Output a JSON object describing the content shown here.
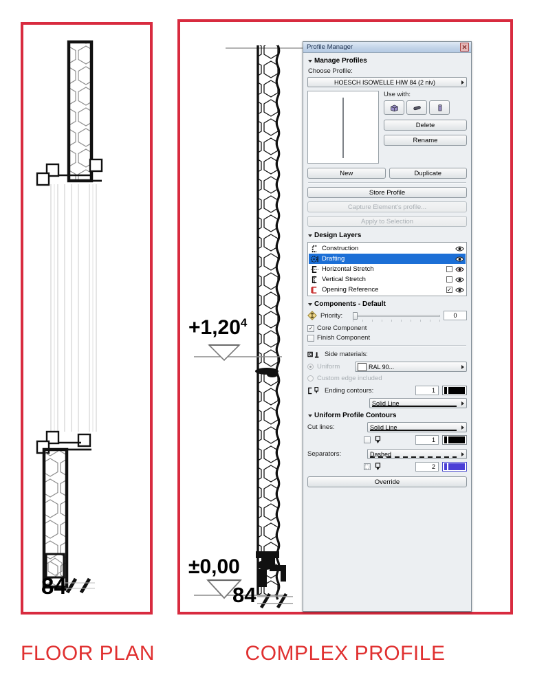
{
  "captions": {
    "floor_plan": "FLOOR PLAN",
    "complex_profile": "COMPLEX PROFILE"
  },
  "colors": {
    "frame_red": "#d82b3f",
    "caption_red": "#e03030",
    "selection_blue": "#1c6fd6",
    "separator_pen": "#4b3fd6"
  },
  "floor_plan_drawing": {
    "dimension_label": "84",
    "hatch": "honeycomb",
    "wall_thickness_label": "84"
  },
  "section_drawing": {
    "upper_level_label": "+1,20",
    "upper_level_superscript": "4",
    "lower_level_label": "±0,00",
    "dimension_label": "84",
    "hatch": "honeycomb"
  },
  "dialog": {
    "title": "Profile Manager",
    "close_icon": "close-icon",
    "manage_profiles": {
      "header": "Manage Profiles",
      "choose_profile_label": "Choose Profile:",
      "selected_profile": "HOESCH ISOWELLE HIW 84 (2 niv)",
      "use_with_label": "Use with:",
      "use_with_icons": [
        "wall-icon",
        "beam-icon",
        "column-icon"
      ],
      "delete_label": "Delete",
      "rename_label": "Rename",
      "new_label": "New",
      "duplicate_label": "Duplicate",
      "store_profile_label": "Store Profile",
      "capture_label": "Capture Element's profile...",
      "apply_label": "Apply to Selection"
    },
    "design_layers": {
      "header": "Design Layers",
      "rows": [
        {
          "name": "Construction",
          "icon": "construction-layer-icon",
          "has_checkbox": false,
          "checked": false,
          "visible": true,
          "selected": false
        },
        {
          "name": "Drafting",
          "icon": "drafting-layer-icon",
          "has_checkbox": false,
          "checked": false,
          "visible": true,
          "selected": true
        },
        {
          "name": "Horizontal Stretch",
          "icon": "horizontal-stretch-layer-icon",
          "has_checkbox": true,
          "checked": false,
          "visible": true,
          "selected": false
        },
        {
          "name": "Vertical Stretch",
          "icon": "vertical-stretch-layer-icon",
          "has_checkbox": true,
          "checked": false,
          "visible": true,
          "selected": false
        },
        {
          "name": "Opening Reference",
          "icon": "opening-reference-layer-icon",
          "has_checkbox": true,
          "checked": true,
          "visible": true,
          "selected": false
        }
      ]
    },
    "components": {
      "header": "Components - Default",
      "priority_label": "Priority:",
      "priority_value": "0",
      "core_component_label": "Core Component",
      "core_component_checked": true,
      "finish_component_label": "Finish Component",
      "finish_component_checked": false,
      "side_materials_label": "Side materials:",
      "uniform_label": "Uniform",
      "uniform_selected": true,
      "uniform_material": "RAL 90...",
      "custom_edge_label": "Custom edge included",
      "custom_edge_selected": false,
      "ending_contours_label": "Ending contours:",
      "ending_contours_pen": "1",
      "ending_contours_linetype": "Solid Line"
    },
    "uniform_profile_contours": {
      "header": "Uniform Profile Contours",
      "cut_lines_label": "Cut lines:",
      "cut_lines_linetype": "Solid Line",
      "cut_lines_pen": "1",
      "cut_lines_checked": false,
      "separators_label": "Separators:",
      "separators_linetype": "Dashed",
      "separators_pen": "2",
      "separators_checked": false,
      "override_label": "Override"
    }
  }
}
